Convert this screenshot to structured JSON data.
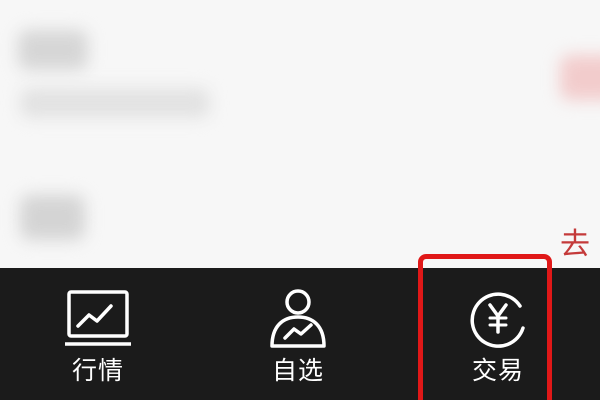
{
  "side_text": "去",
  "tabs": [
    {
      "label": "行情",
      "icon": "market-chart-icon"
    },
    {
      "label": "自选",
      "icon": "watchlist-user-icon"
    },
    {
      "label": "交易",
      "icon": "yen-coin-icon",
      "highlighted": true
    }
  ],
  "colors": {
    "tabbar_background": "#1b1b1b",
    "tab_label": "#ffffff",
    "highlight_outline": "#e01818",
    "side_text": "#c43a3a"
  }
}
